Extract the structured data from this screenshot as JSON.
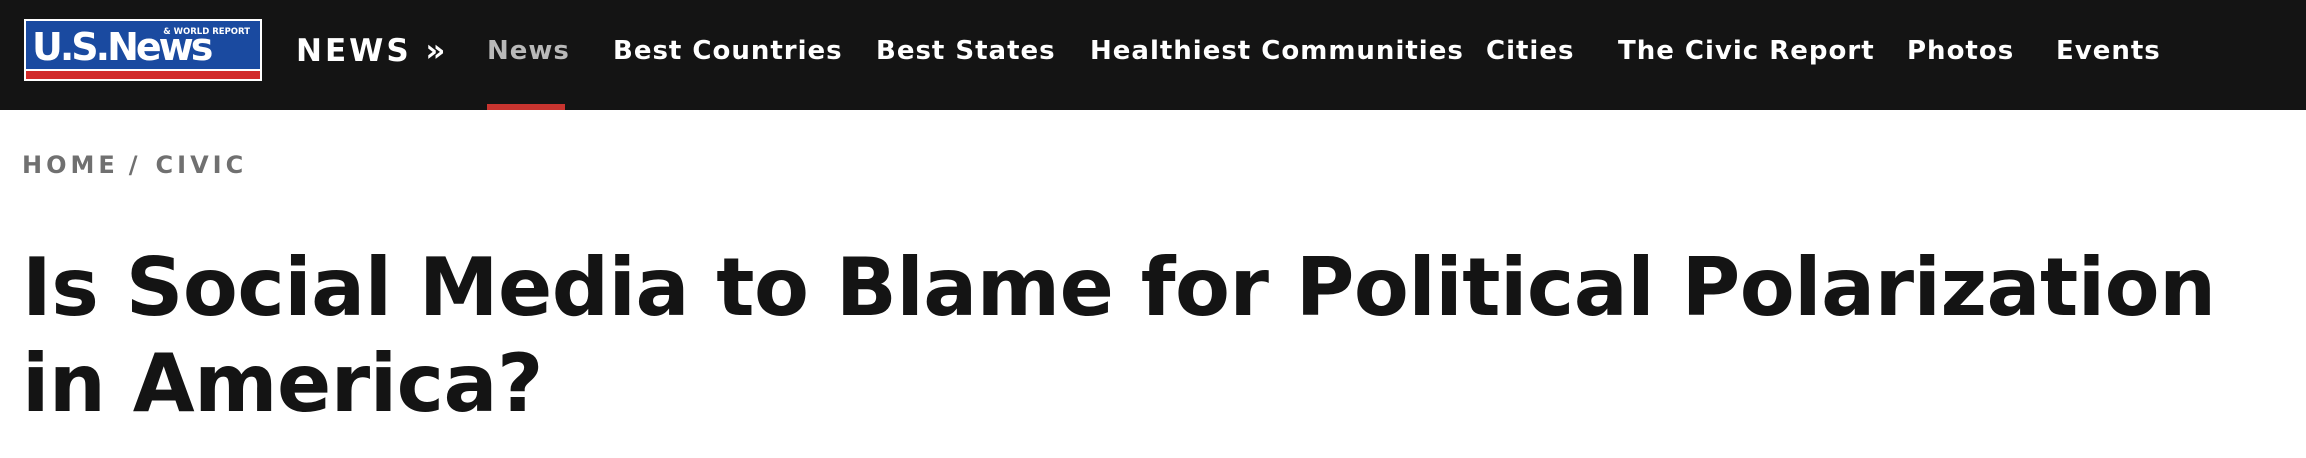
{
  "logo": {
    "main": "U.S.News",
    "sub": "& WORLD REPORT"
  },
  "section_label": "NEWS »",
  "nav": {
    "items": [
      {
        "label": "News",
        "active": true
      },
      {
        "label": "Best Countries",
        "active": false
      },
      {
        "label": "Best States",
        "active": false
      },
      {
        "label": "Healthiest Communities",
        "active": false
      },
      {
        "label": "Cities",
        "active": false
      },
      {
        "label": "The Civic Report",
        "active": false
      },
      {
        "label": "Photos",
        "active": false
      },
      {
        "label": "Events",
        "active": false
      }
    ]
  },
  "breadcrumb": {
    "home": "HOME",
    "separator": "/",
    "current": "CIVIC"
  },
  "headline": "Is Social Media to Blame for Political Polarization in America?",
  "colors": {
    "nav_bg": "#141414",
    "active_underline": "#c8342f",
    "logo_blue": "#1a4aa0",
    "logo_red": "#d12b2b"
  }
}
